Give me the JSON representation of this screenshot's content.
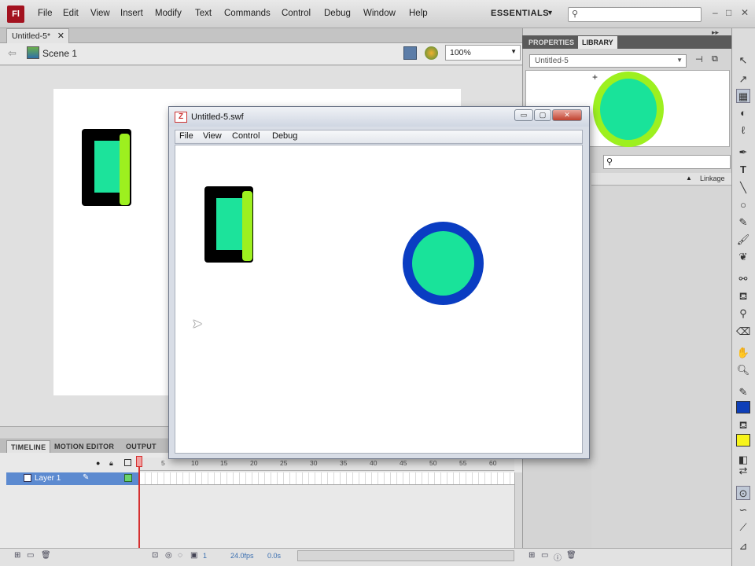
{
  "menubar": {
    "logo": "Fl",
    "items": [
      "File",
      "Edit",
      "View",
      "Insert",
      "Modify",
      "Text",
      "Commands",
      "Control",
      "Debug",
      "Window",
      "Help"
    ],
    "workspace": "ESSENTIALS",
    "search_placeholder": "",
    "window_controls": [
      "–",
      "□",
      "✕"
    ]
  },
  "document": {
    "tab_label": "Untitled-5*",
    "scene_label": "Scene 1",
    "zoom": "100%"
  },
  "timeline": {
    "tabs": [
      "TIMELINE",
      "MOTION EDITOR",
      "OUTPUT"
    ],
    "layer_name": "Layer 1",
    "ruler_numbers": [
      "1",
      "5",
      "10",
      "15",
      "20",
      "25",
      "30",
      "35",
      "40",
      "45",
      "50",
      "55",
      "60"
    ],
    "current_frame": "1",
    "fps": "24.0fps",
    "time": "0.0s"
  },
  "panels": {
    "tabs": [
      "PROPERTIES",
      "LIBRARY"
    ],
    "library_doc": "Untitled-5",
    "linkage_label": "Linkage",
    "search_placeholder": ""
  },
  "swf_window": {
    "title": "Untitled-5.swf",
    "menu": [
      "File",
      "View",
      "Control",
      "Debug"
    ]
  },
  "colors": {
    "shape_fill": "#1ce39b",
    "shape_edge": "#9df01f",
    "shape_stroke": "#000000",
    "circle_stroke_swf": "#0a3dc2",
    "library_circle_stroke": "#9df01f",
    "stroke_swatch": "#0e3fb8",
    "fill_swatch": "#f7f41a"
  }
}
